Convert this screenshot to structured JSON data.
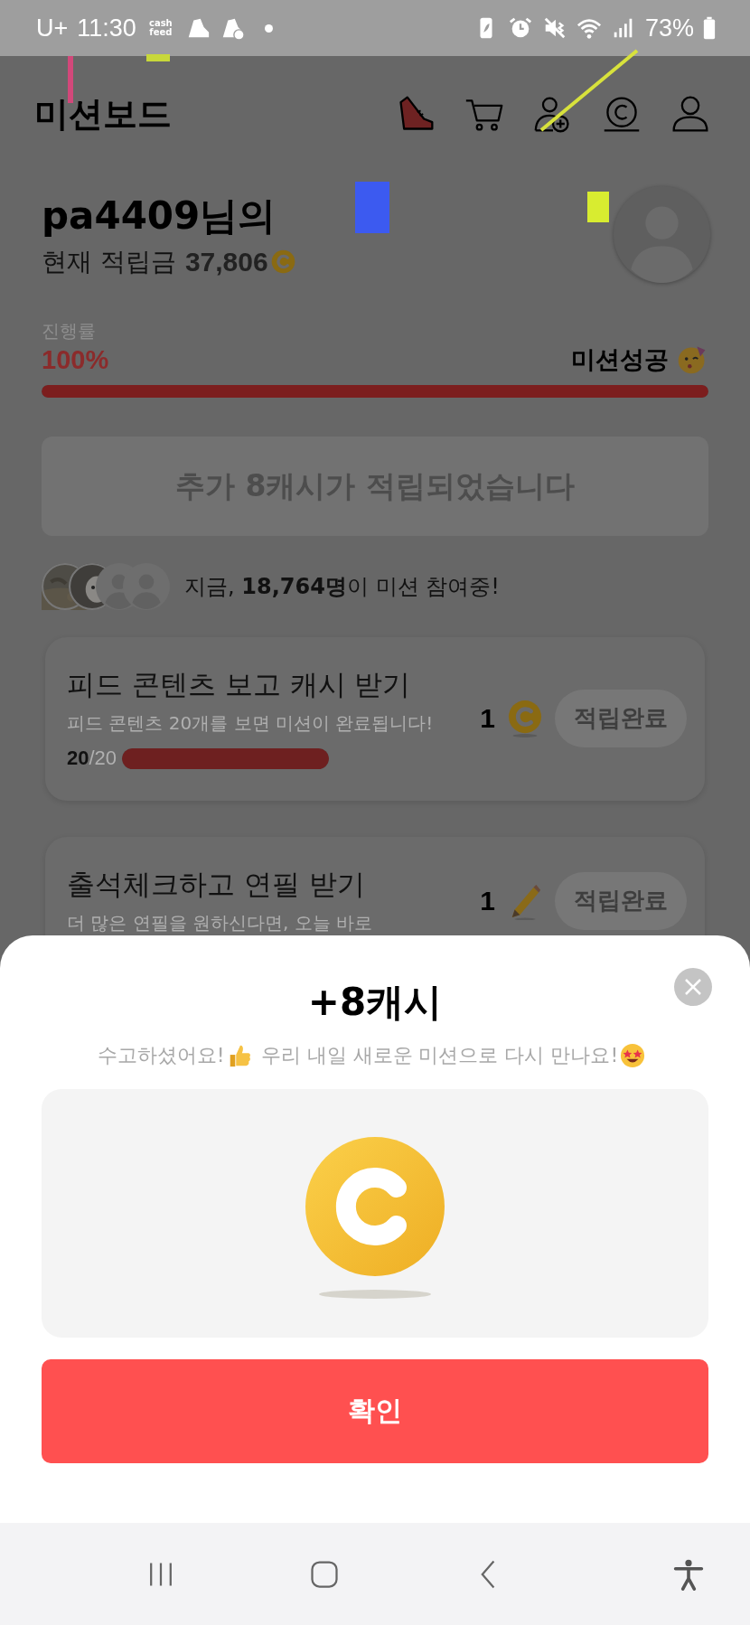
{
  "status_bar": {
    "carrier": "U+",
    "time": "11:30",
    "app_badge": "cash feed",
    "battery": "73%"
  },
  "header": {
    "title": "미션보드"
  },
  "user": {
    "name": "pa4409님의",
    "balance_label": "현재 적립금",
    "balance": "37,806"
  },
  "progress": {
    "label": "진행률",
    "percent": "100%",
    "status": "미션성공",
    "level": 1
  },
  "banner": {
    "text": "추가 8캐시가 적립되었습니다"
  },
  "participants": {
    "text": "지금, **18,764명**이 미션 참여중!",
    "avatars": [
      {
        "kind": "picture"
      },
      {
        "kind": "picture"
      },
      {
        "kind": "default"
      },
      {
        "kind": "default"
      }
    ]
  },
  "missions": [
    {
      "title": "피드 콘텐츠 보고 캐시 받기",
      "description": "피드 콘텐츠 20개를 보면 미션이 완료됩니다!",
      "count": "20",
      "total": "/20",
      "level": 1,
      "reward": "1",
      "kind": "coin",
      "button": "적립완료",
      "completed": true
    },
    {
      "title": "출석체크하고 연필 받기",
      "description": "더 많은 연필을 원하신다면, 오늘 바로",
      "reward": "1",
      "kind": "pencil",
      "button": "적립완료",
      "completed": true
    }
  ],
  "dialog": {
    "title": "+8캐시",
    "message_parts": [
      "수고하셨어요!",
      "우리 내일 새로운 미션으로 다시 만나요!"
    ],
    "button": "확인"
  }
}
